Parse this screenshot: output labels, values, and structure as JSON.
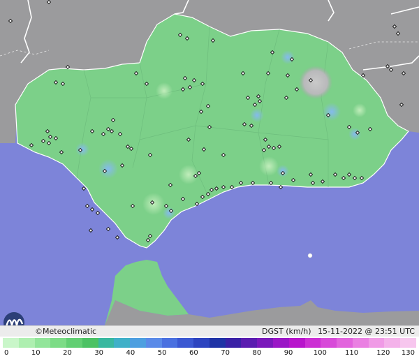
{
  "map": {
    "region": "Andalusia",
    "colors": {
      "sea": "#7d84d9",
      "land_outside": "#9a9a9c",
      "land_low_gust": "#7fd08a",
      "land_mid_gust": "#5ec070",
      "hotspot_blue": "#7fb0ff",
      "border": "#ffffff"
    },
    "stations_icon": "diamond-station-icon",
    "buoy_icon": "buoy-icon"
  },
  "info_bar": {
    "brand": "©Meteoclimatic",
    "variable": "DGST (km/h)",
    "datetime": "15-11-2022 @ 23:51 UTC"
  },
  "scale": {
    "labels": [
      "0",
      "10",
      "20",
      "30",
      "40",
      "50",
      "60",
      "70",
      "80",
      "90",
      "100",
      "110",
      "120",
      "130"
    ],
    "colors": [
      "#c9f6c9",
      "#aeefb0",
      "#92e59a",
      "#7cdc86",
      "#62cf73",
      "#4cc264",
      "#39b8a0",
      "#3fb0c8",
      "#4d9fe0",
      "#5a8ae8",
      "#4a70e0",
      "#3b58d2",
      "#2d44c0",
      "#1f33a6",
      "#3a21a6",
      "#5a1cb0",
      "#7a18bb",
      "#9a16c6",
      "#b814cc",
      "#cc2fd4",
      "#d84ad9",
      "#e264dd",
      "#ea80e2",
      "#f09be6",
      "#f4b2ea",
      "#f7c6ee"
    ]
  }
}
